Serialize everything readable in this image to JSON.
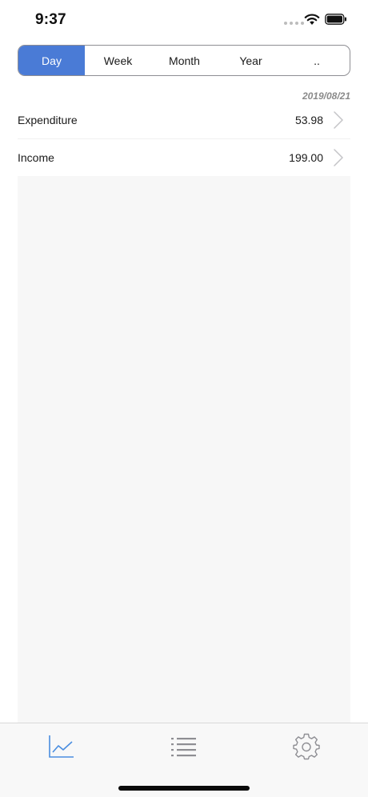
{
  "status_bar": {
    "time": "9:37"
  },
  "segments": [
    {
      "label": "Day",
      "active": true
    },
    {
      "label": "Week",
      "active": false
    },
    {
      "label": "Month",
      "active": false
    },
    {
      "label": "Year",
      "active": false
    },
    {
      "label": "..",
      "active": false
    }
  ],
  "date": "2019/08/21",
  "rows": [
    {
      "label": "Expenditure",
      "value": "53.98"
    },
    {
      "label": "Income",
      "value": "199.00"
    }
  ],
  "tabs": [
    {
      "icon": "chart-line-icon",
      "active": true
    },
    {
      "icon": "list-icon",
      "active": false
    },
    {
      "icon": "gear-icon",
      "active": false
    }
  ],
  "colors": {
    "accent": "#4a7bd6",
    "tab_active": "#4a8ee0",
    "tab_inactive": "#8e8e93",
    "panel_bg": "#f7f7f7"
  }
}
